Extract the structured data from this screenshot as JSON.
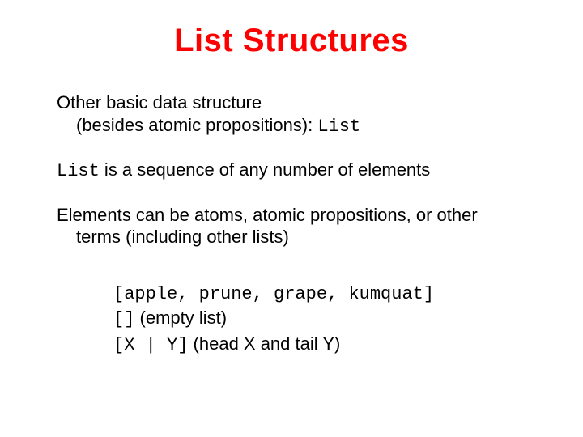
{
  "title": "List Structures",
  "para1_line1": "Other basic data structure",
  "para1_line2a": "(besides atomic propositions): ",
  "para1_line2_code": "List",
  "para2_code": "List",
  "para2_rest": " is a sequence of any number of elements",
  "para3": "Elements can be atoms, atomic propositions, or other terms (including other lists)",
  "examples": {
    "ex1": "[apple, prune, grape, kumquat]",
    "ex2_code": "[]",
    "ex2_note": " (empty list)",
    "ex3_code": "[X | Y]",
    "ex3_note": " (head X and tail Y)"
  }
}
